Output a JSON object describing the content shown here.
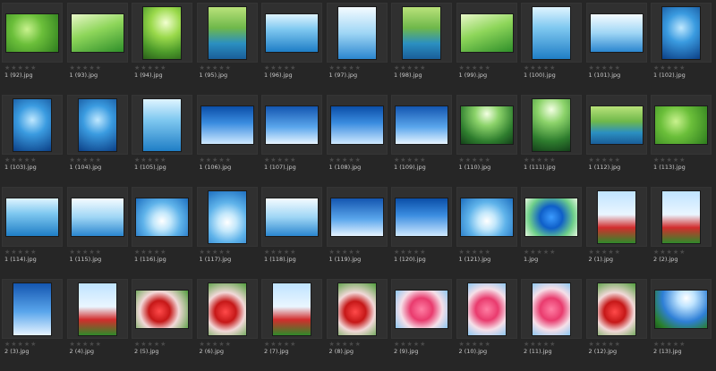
{
  "thumbnails": [
    {
      "file": "1 (92).jpg",
      "orient": "landscape",
      "palette": "p-green"
    },
    {
      "file": "1 (93).jpg",
      "orient": "landscape",
      "palette": "p-green2"
    },
    {
      "file": "1 (94).jpg",
      "orient": "portrait",
      "palette": "p-leaf"
    },
    {
      "file": "1 (95).jpg",
      "orient": "portrait",
      "palette": "p-waterleaf"
    },
    {
      "file": "1 (96).jpg",
      "orient": "landscape",
      "palette": "p-aqua"
    },
    {
      "file": "1 (97).jpg",
      "orient": "portrait",
      "palette": "p-aqua2"
    },
    {
      "file": "1 (98).jpg",
      "orient": "portrait",
      "palette": "p-waterleaf"
    },
    {
      "file": "1 (99).jpg",
      "orient": "landscape",
      "palette": "p-green2"
    },
    {
      "file": "1 (100).jpg",
      "orient": "portrait",
      "palette": "p-aqua"
    },
    {
      "file": "1 (101).jpg",
      "orient": "landscape",
      "palette": "p-aqua2"
    },
    {
      "file": "1 (102).jpg",
      "orient": "portrait",
      "palette": "p-deep"
    },
    {
      "file": "1 (103).jpg",
      "orient": "portrait",
      "palette": "p-deep"
    },
    {
      "file": "1 (104).jpg",
      "orient": "portrait",
      "palette": "p-deep"
    },
    {
      "file": "1 (105).jpg",
      "orient": "portrait",
      "palette": "p-aqua"
    },
    {
      "file": "1 (106).jpg",
      "orient": "landscape",
      "palette": "p-sky"
    },
    {
      "file": "1 (107).jpg",
      "orient": "landscape",
      "palette": "p-sky2"
    },
    {
      "file": "1 (108).jpg",
      "orient": "landscape",
      "palette": "p-sky"
    },
    {
      "file": "1 (109).jpg",
      "orient": "landscape",
      "palette": "p-sky2"
    },
    {
      "file": "1 (110).jpg",
      "orient": "landscape",
      "palette": "p-forest"
    },
    {
      "file": "1 (111).jpg",
      "orient": "portrait",
      "palette": "p-forest"
    },
    {
      "file": "1 (112).jpg",
      "orient": "landscape",
      "palette": "p-waterleaf"
    },
    {
      "file": "1 (113).jpg",
      "orient": "landscape",
      "palette": "p-green"
    },
    {
      "file": "1 (114).jpg",
      "orient": "landscape",
      "palette": "p-aqua"
    },
    {
      "file": "1 (115).jpg",
      "orient": "landscape",
      "palette": "p-aqua2"
    },
    {
      "file": "1 (116).jpg",
      "orient": "landscape",
      "palette": "p-ripple"
    },
    {
      "file": "1 (117).jpg",
      "orient": "portrait",
      "palette": "p-ripple"
    },
    {
      "file": "1 (118).jpg",
      "orient": "landscape",
      "palette": "p-aqua2"
    },
    {
      "file": "1 (119).jpg",
      "orient": "landscape",
      "palette": "p-sky2"
    },
    {
      "file": "1 (120).jpg",
      "orient": "landscape",
      "palette": "p-sky"
    },
    {
      "file": "1 (121).jpg",
      "orient": "landscape",
      "palette": "p-ripple"
    },
    {
      "file": "1.jpg",
      "orient": "landscape",
      "palette": "p-globe"
    },
    {
      "file": "2 (1).jpg",
      "orient": "portrait",
      "palette": "p-poppy"
    },
    {
      "file": "2 (2).jpg",
      "orient": "portrait",
      "palette": "p-poppy"
    },
    {
      "file": "2 (3).jpg",
      "orient": "portrait",
      "palette": "p-sky2"
    },
    {
      "file": "2 (4).jpg",
      "orient": "portrait",
      "palette": "p-poppy"
    },
    {
      "file": "2 (5).jpg",
      "orient": "landscape",
      "palette": "p-poppy2"
    },
    {
      "file": "2 (6).jpg",
      "orient": "portrait",
      "palette": "p-poppy2"
    },
    {
      "file": "2 (7).jpg",
      "orient": "portrait",
      "palette": "p-poppy"
    },
    {
      "file": "2 (8).jpg",
      "orient": "portrait",
      "palette": "p-poppy2"
    },
    {
      "file": "2 (9).jpg",
      "orient": "landscape",
      "palette": "p-pink"
    },
    {
      "file": "2 (10).jpg",
      "orient": "portrait",
      "palette": "p-pink"
    },
    {
      "file": "2 (11).jpg",
      "orient": "portrait",
      "palette": "p-pink"
    },
    {
      "file": "2 (12).jpg",
      "orient": "portrait",
      "palette": "p-poppy2"
    },
    {
      "file": "2 (13).jpg",
      "orient": "landscape",
      "palette": "p-sun"
    }
  ],
  "rating_glyphs": "★★★★★",
  "colors": {
    "background": "#262626",
    "tile": "#303030",
    "filename_text": "#c9c9c9",
    "rating_stars": "#4a4a4a"
  }
}
